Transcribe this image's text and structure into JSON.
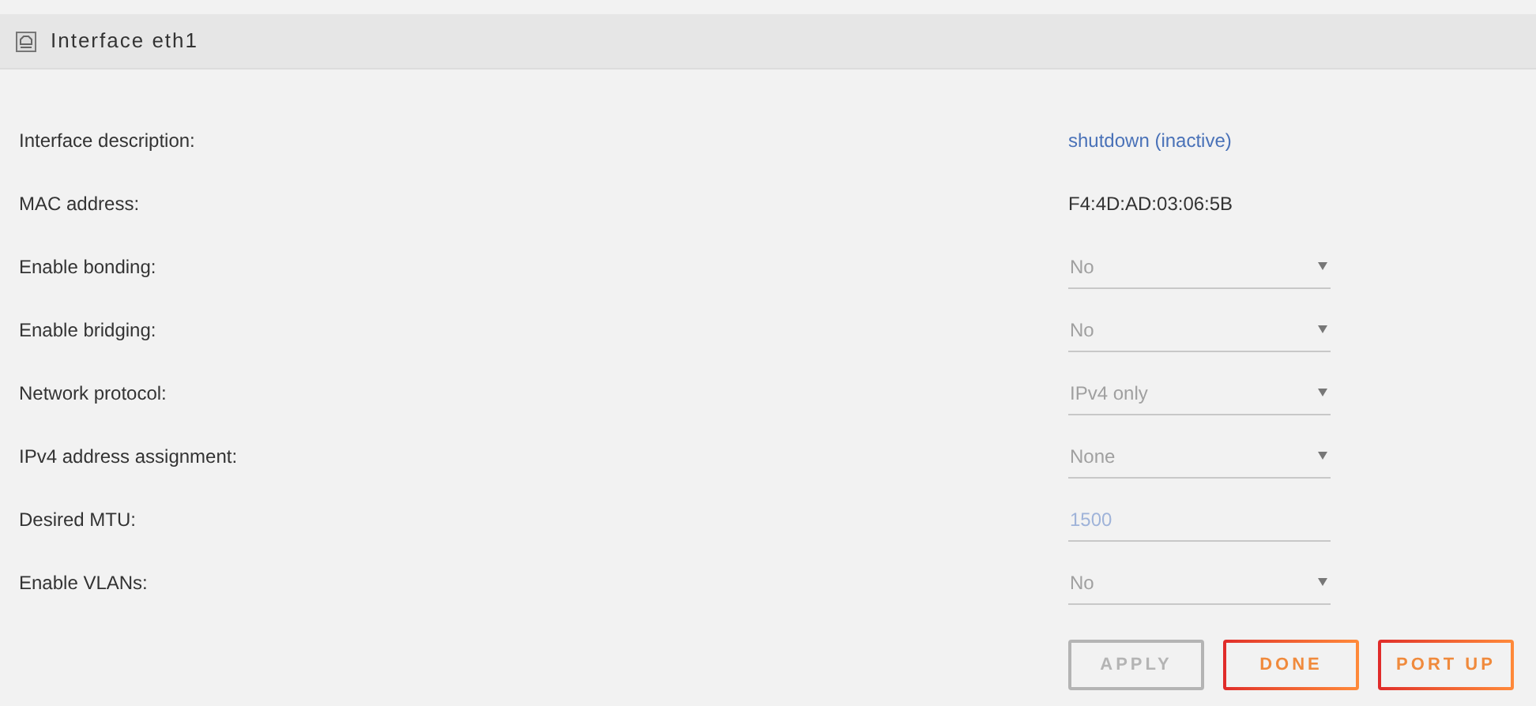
{
  "panel": {
    "title": "Interface eth1"
  },
  "fields": [
    {
      "label": "Interface description:",
      "kind": "link",
      "value": "shutdown (inactive)"
    },
    {
      "label": "MAC address:",
      "kind": "text",
      "value": "F4:4D:AD:03:06:5B"
    },
    {
      "label": "Enable bonding:",
      "kind": "select",
      "value": "No"
    },
    {
      "label": "Enable bridging:",
      "kind": "select",
      "value": "No"
    },
    {
      "label": "Network protocol:",
      "kind": "select",
      "value": "IPv4 only"
    },
    {
      "label": "IPv4 address assignment:",
      "kind": "select",
      "value": "None"
    },
    {
      "label": "Desired MTU:",
      "kind": "input",
      "placeholder": "1500"
    },
    {
      "label": "Enable VLANs:",
      "kind": "select",
      "value": "No"
    }
  ],
  "buttons": [
    {
      "label": "APPLY",
      "disabled": true
    },
    {
      "label": "DONE",
      "disabled": false
    },
    {
      "label": "PORT UP",
      "disabled": false
    }
  ]
}
